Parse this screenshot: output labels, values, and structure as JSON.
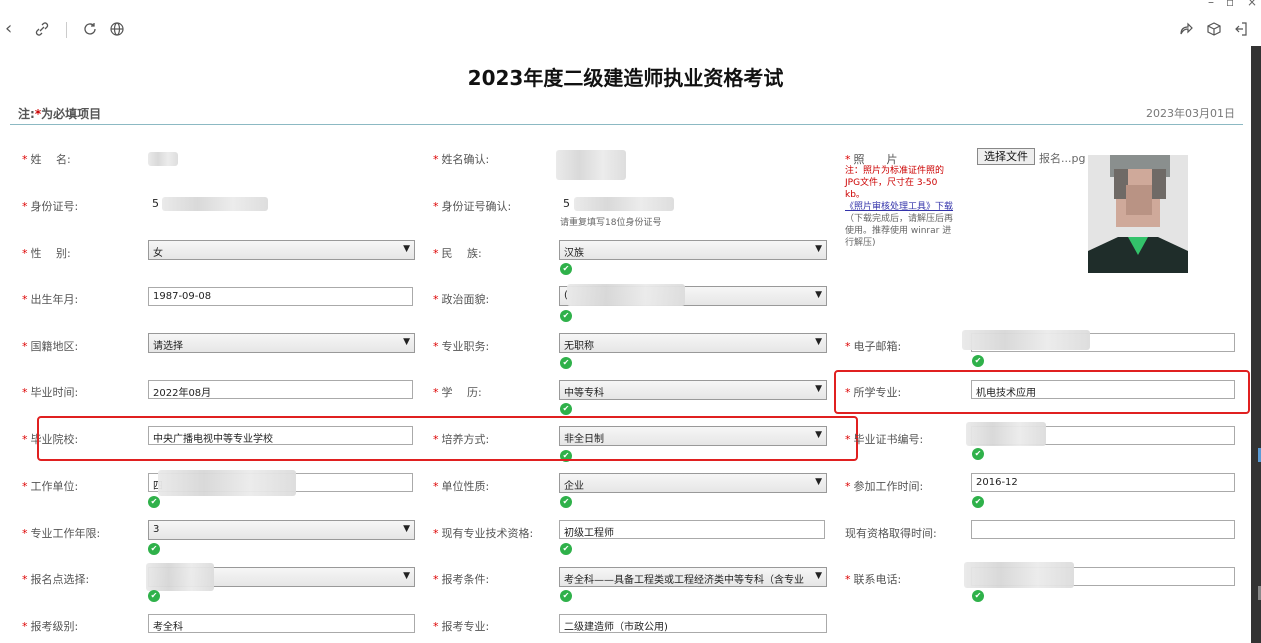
{
  "browser": {
    "back": "‹",
    "link_icon": "link",
    "refresh_icon": "refresh",
    "globe_icon": "globe",
    "share_icon": "share",
    "cube_icon": "cube",
    "exit_icon": "exit"
  },
  "page": {
    "title": "2023年度二级建造师执业资格考试",
    "note_prefix": "注:",
    "note_star": "*",
    "note_text": "为必填项目",
    "date": "2023年03月01日"
  },
  "form": {
    "name_label": "姓　 名:",
    "name_confirm_label": "姓名确认:",
    "photo_label": "照　　片",
    "photo_button": "选择文件",
    "photo_filename": "报名...pg",
    "photo_note_red": "注：照片为标准证件照的JPG文件，尺寸在 3-50 kb。",
    "photo_note_link": "《照片审核处理工具》下载",
    "photo_note_rest": "（下载完成后，请解压后再使用。推荐使用 winrar 进行解压)",
    "id_label": "身份证号:",
    "id_value": "5",
    "id_confirm_label": "身份证号确认:",
    "id_confirm_value": "5",
    "id_hint": "请重复填写18位身份证号",
    "gender_label": "性　 别:",
    "gender_value": "女",
    "ethnic_label": "民　 族:",
    "ethnic_value": "汉族",
    "birth_label": "出生年月:",
    "birth_value": "1987-09-08",
    "politics_label": "政治面貌:",
    "politics_value": "(",
    "nation_label": "国籍地区:",
    "nation_value": "请选择",
    "title_label": "专业职务:",
    "title_value": "无职称",
    "email_label": "电子邮箱:",
    "grad_time_label": "毕业时间:",
    "grad_time_value": "2022年08月",
    "edu_label": "学　 历:",
    "edu_value": "中等专科",
    "major_label": "所学专业:",
    "major_value": "机电技术应用",
    "school_label": "毕业院校:",
    "school_value": "中央广播电视中等专业学校",
    "train_label": "培养方式:",
    "train_value": "非全日制",
    "cert_label": "毕业证书编号:",
    "work_unit_label": "工作单位:",
    "work_unit_value": "四",
    "unit_type_label": "单位性质:",
    "unit_type_value": "企业",
    "work_start_label": "参加工作时间:",
    "work_start_value": "2016-12",
    "years_label": "专业工作年限:",
    "years_value": "3",
    "tech_label": "现有专业技术资格:",
    "tech_value": "初级工程师",
    "tech_time_label": "现有资格取得时间:",
    "site_label": "报名点选择:",
    "cond_label": "报考条件:",
    "cond_value": "考全科——具备工程类或工程经济类中等专科（含专业",
    "phone_label": "联系电话:",
    "level_label": "报考级别:",
    "level_value": "考全科",
    "spec_label": "报考专业:",
    "spec_value": "二级建造师（市政公用)"
  },
  "colors": {
    "accent_line": "#8cb9c3",
    "required": "#d00000",
    "ok": "#2fb14a",
    "highlight": "#e02020"
  }
}
